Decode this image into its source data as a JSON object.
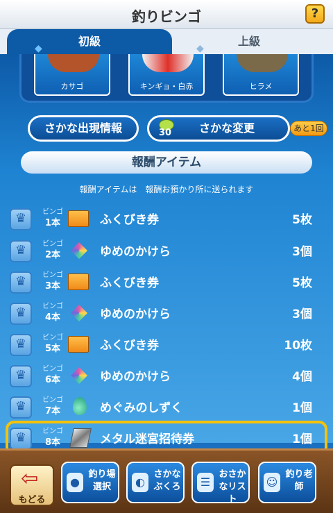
{
  "header": {
    "title": "釣りビンゴ",
    "help_label": "?"
  },
  "tabs": [
    {
      "label": "初級"
    },
    {
      "label": "上級"
    }
  ],
  "fish_cards": [
    {
      "name": "カサゴ",
      "color": "#b4542a"
    },
    {
      "name": "キンギョ・白赤",
      "color": "#f2f2f2"
    },
    {
      "name": "ヒラメ",
      "color": "#7a6a4a"
    }
  ],
  "buttons": {
    "appearance_info": "さかな出現情報",
    "change_fish": "さかな変更",
    "change_cost": "30",
    "remaining_badge": "あと1回"
  },
  "reward_section": {
    "title": "報酬アイテム",
    "note": "報酬アイテムは　報酬お預かり所に送られます"
  },
  "rewards": [
    {
      "bingo_label": "ビンゴ",
      "lines": "1本",
      "item": "ふくびき券",
      "qty": "5枚",
      "icon": "ticket"
    },
    {
      "bingo_label": "ビンゴ",
      "lines": "2本",
      "item": "ゆめのかけら",
      "qty": "3個",
      "icon": "gem"
    },
    {
      "bingo_label": "ビンゴ",
      "lines": "3本",
      "item": "ふくびき券",
      "qty": "5枚",
      "icon": "ticket"
    },
    {
      "bingo_label": "ビンゴ",
      "lines": "4本",
      "item": "ゆめのかけら",
      "qty": "3個",
      "icon": "gem"
    },
    {
      "bingo_label": "ビンゴ",
      "lines": "5本",
      "item": "ふくびき券",
      "qty": "10枚",
      "icon": "ticket"
    },
    {
      "bingo_label": "ビンゴ",
      "lines": "6本",
      "item": "ゆめのかけら",
      "qty": "4個",
      "icon": "gem"
    },
    {
      "bingo_label": "ビンゴ",
      "lines": "7本",
      "item": "めぐみのしずく",
      "qty": "1個",
      "icon": "drop"
    },
    {
      "bingo_label": "ビンゴ",
      "lines": "8本",
      "item": "メタル迷宮招待券",
      "qty": "1個",
      "icon": "metal"
    }
  ],
  "footer": {
    "back": "もどる",
    "fishing_spot": "釣り場選択",
    "fish_bag": "さかなぶくろ",
    "fish_list": "おさかなリスト",
    "fishing_master": "釣り老師"
  },
  "colors": {
    "highlight": "#f5c20a",
    "primary": "#0d5aa7"
  }
}
